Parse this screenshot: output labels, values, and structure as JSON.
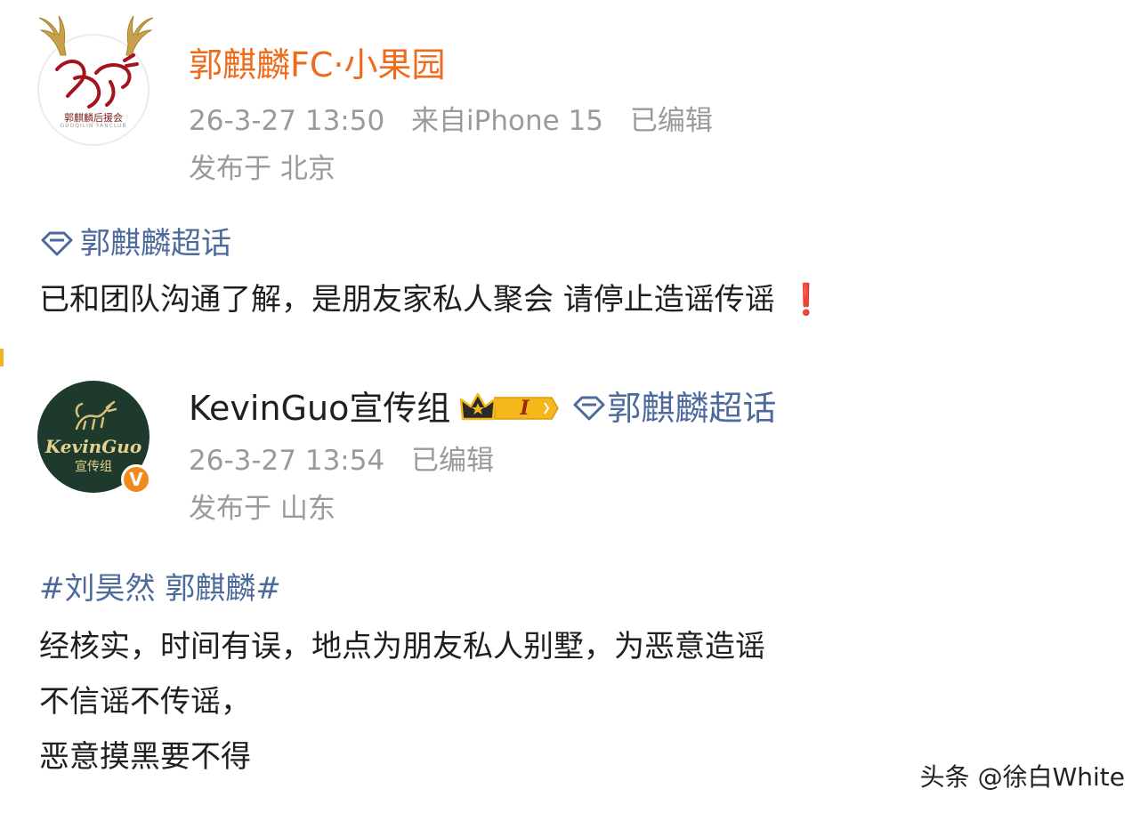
{
  "post1": {
    "author": "郭麒麟FC·小果园",
    "avatar_caption": "郭麒麟后援会",
    "avatar_sub": "GUOQILIN FANCLUB",
    "time": "26-3-27 13:50",
    "source": "来自iPhone 15",
    "edited": "已编辑",
    "location": "发布于 北京",
    "topic": "郭麒麟超话",
    "body": "已和团队沟通了解，是朋友家私人聚会 请停止造谣传谣",
    "exclaim": "❗"
  },
  "post2": {
    "author": "KevinGuo宣传组",
    "avatar_line1": "KevinGuo",
    "avatar_line2": "宣传组",
    "level_badge": "I",
    "topic": "郭麒麟超话",
    "time": "26-3-27 13:54",
    "edited": "已编辑",
    "location": "发布于 山东",
    "hashtag": "#刘昊然 郭麒麟#",
    "body_lines": [
      "经核实，时间有误，地点为朋友私人别墅，为恶意造谣",
      "不信谣不传谣，",
      "恶意摸黑要不得"
    ],
    "verified_mark": "V"
  },
  "watermark": "头条 @徐白White",
  "colors": {
    "name_orange": "#ee6b1b",
    "topic_blue": "#4d6a9c",
    "meta_gray": "#9a9a9a",
    "avatar_green": "#1e3a2c",
    "verified_orange": "#f08a1c",
    "badge_gold": "#f5b81c"
  },
  "icons": [
    "antler-icon",
    "diamond-topic-icon",
    "crown-badge-icon",
    "verified-icon"
  ]
}
